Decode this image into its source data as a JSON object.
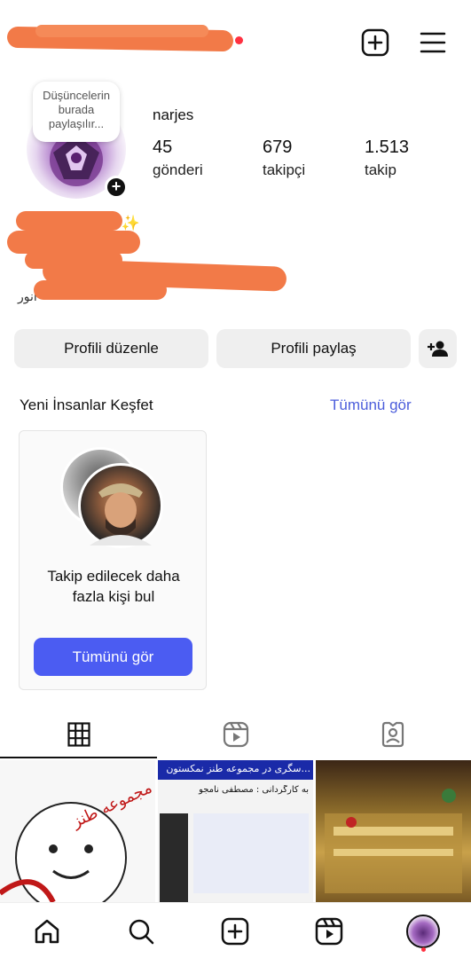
{
  "header": {
    "username_redacted": true,
    "create_icon": "plus-square-icon",
    "menu_icon": "hamburger-menu-icon"
  },
  "profile": {
    "note": "Düşüncelerin burada paylaşılır...",
    "display_name": "narjes",
    "stats": [
      {
        "value": "45",
        "label": "gönderi"
      },
      {
        "value": "679",
        "label": "takipçi"
      },
      {
        "value": "1.513",
        "label": "takip"
      }
    ],
    "bio_visible_fragment": "ge✨",
    "bio_visible_fragment2": "انور"
  },
  "actions": {
    "edit_label": "Profili düzenle",
    "share_label": "Profili paylaş",
    "add_person_icon": "add-person-icon"
  },
  "discover": {
    "title": "Yeni İnsanlar Keşfet",
    "see_all": "Tümünü gör",
    "card_text": "Takip edilecek daha fazla kişi bul",
    "card_button": "Tümünü gör"
  },
  "tabs": [
    {
      "name": "posts",
      "icon": "grid-icon",
      "active": true
    },
    {
      "name": "reels",
      "icon": "reels-icon",
      "active": false
    },
    {
      "name": "tagged",
      "icon": "tagged-person-icon",
      "active": false
    }
  ],
  "grid_posts": [
    {
      "caption": "مجموعه طنز"
    },
    {
      "caption": "...سگری در مجموعه طنز نمکستون",
      "subcaption": "به کارگردانی : مصطفی نامجو"
    },
    {
      "caption": ""
    }
  ],
  "colors": {
    "accent": "#4b5cf2",
    "link": "#4b5ddb",
    "button_bg": "#efefef",
    "notification": "#ff3040"
  }
}
